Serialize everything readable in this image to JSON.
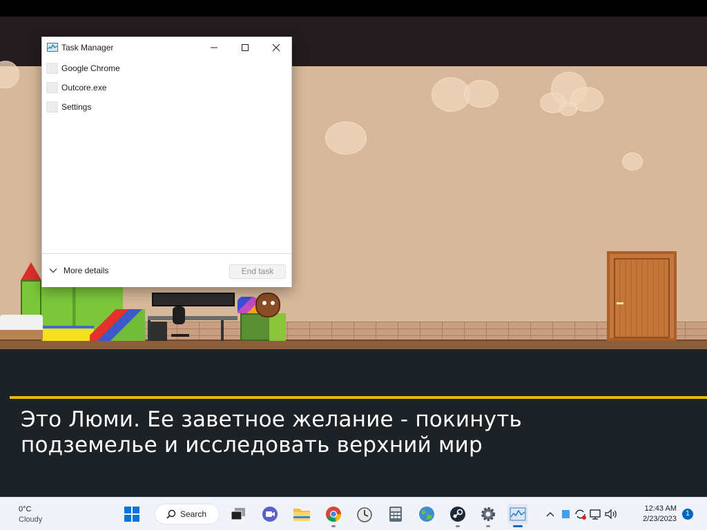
{
  "task_manager": {
    "title": "Task Manager",
    "processes": [
      {
        "name": "Google Chrome"
      },
      {
        "name": "Outcore.exe"
      },
      {
        "name": "Settings"
      }
    ],
    "more_details_label": "More details",
    "end_task_label": "End task",
    "icons": {
      "app": "task-manager-icon",
      "minimize": "minimize-icon",
      "maximize": "maximize-icon",
      "close": "close-icon",
      "expand": "chevron-down-icon"
    }
  },
  "game": {
    "caption_line1": "Это Люми. Ее заветное желание - покинуть",
    "caption_line2": "подземелье и исследовать верхний мир",
    "colors": {
      "wall": "#d7b89a",
      "caption_bar": "#f2b70a",
      "dark_band": "#1d2226"
    }
  },
  "taskbar": {
    "weather": {
      "temp": "0°C",
      "condition": "Cloudy"
    },
    "search_label": "Search",
    "pinned": [
      "start-icon",
      "search-icon",
      "task-view-icon",
      "video-chat-icon",
      "file-explorer-icon",
      "chrome-icon",
      "clock-app-icon",
      "calculator-icon",
      "globe-icon",
      "steam-icon",
      "settings-icon",
      "task-manager-icon"
    ],
    "clock": {
      "time": "12:43 AM",
      "date": "2/23/2023"
    },
    "notification_count": "1",
    "tray": [
      "chevron-up-icon",
      "app-tray-icon",
      "sync-icon",
      "network-icon",
      "volume-icon"
    ]
  }
}
